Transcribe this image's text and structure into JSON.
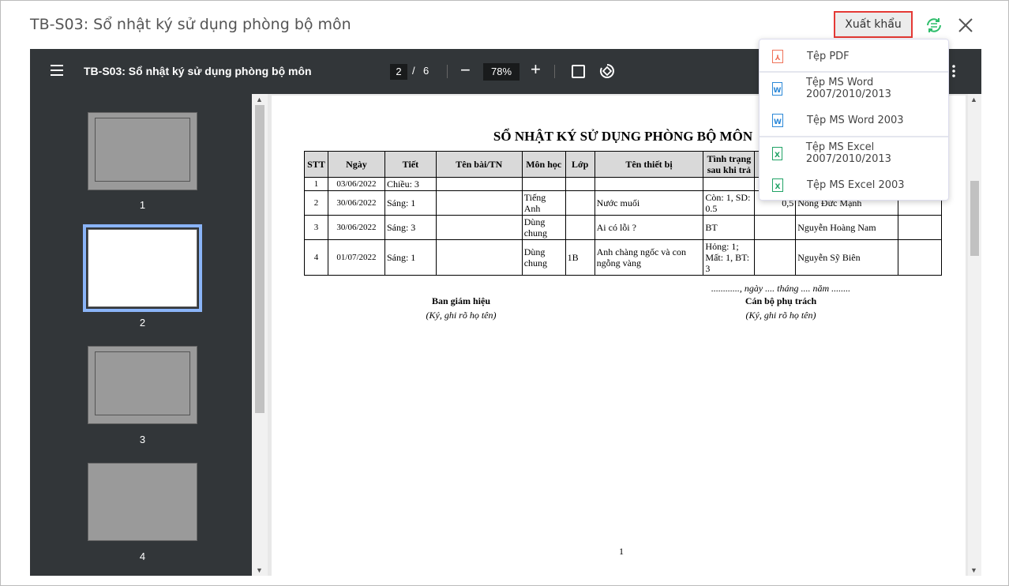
{
  "window": {
    "title": "TB-S03: Sổ nhật ký sử dụng phòng bộ môn",
    "export_label": "Xuất khẩu"
  },
  "export_menu": [
    {
      "label": "Tệp PDF",
      "icon": "pdf-icon",
      "color": "#f0735a"
    },
    {
      "label": "Tệp MS Word 2007/2010/2013",
      "icon": "word-icon",
      "color": "#2b88d8"
    },
    {
      "label": "Tệp MS Word 2003",
      "icon": "word-icon",
      "color": "#2b88d8"
    },
    {
      "label": "Tệp MS Excel 2007/2010/2013",
      "icon": "excel-icon",
      "color": "#21a366"
    },
    {
      "label": "Tệp MS Excel 2003",
      "icon": "excel-icon",
      "color": "#21a366"
    }
  ],
  "viewer": {
    "doc_title": "TB-S03: Sổ nhật ký sử dụng phòng bộ môn",
    "current_page": "2",
    "total_pages": "6",
    "slash": "/",
    "zoom": "78%"
  },
  "thumbnails": [
    "1",
    "2",
    "3",
    "4"
  ],
  "document": {
    "title": "SỔ NHẬT KÝ SỬ DỤNG PHÒNG BỘ MÔN",
    "headers": [
      "STT",
      "Ngày",
      "Tiết",
      "Tên bài/TN",
      "Môn học",
      "Lớp",
      "Tên thiết bị",
      "Tình trạng sau khi trả",
      "",
      "",
      ""
    ],
    "rows": [
      [
        "1",
        "03/06/2022",
        "Chiều: 3",
        "",
        "",
        "",
        "",
        "",
        "",
        "",
        ""
      ],
      [
        "2",
        "30/06/2022",
        "Sáng: 1",
        "",
        "Tiếng Anh",
        "",
        "Nước muối",
        "Còn: 1, SD: 0.5",
        "0,5",
        "Nông Đức Mạnh",
        ""
      ],
      [
        "3",
        "30/06/2022",
        "Sáng: 3",
        "",
        "Dùng chung",
        "",
        "Ai có lỗi ?",
        "BT",
        "",
        "Nguyễn Hoàng Nam",
        ""
      ],
      [
        "4",
        "01/07/2022",
        "Sáng: 1",
        "",
        "Dùng chung",
        "1B",
        "Anh chàng ngốc và con ngỗng vàng",
        "Hỏng: 1; Mất: 1, BT: 3",
        "",
        "Nguyễn Sỹ Biên",
        ""
      ]
    ],
    "date_line": "............, ngày .... tháng .... năm ........",
    "left_sig_title": "Ban giám hiệu",
    "left_sig_note": "(Ký, ghi rõ họ tên)",
    "right_sig_title": "Cán bộ phụ trách",
    "right_sig_note": "(Ký, ghi rõ họ tên)",
    "page_number": "1"
  }
}
